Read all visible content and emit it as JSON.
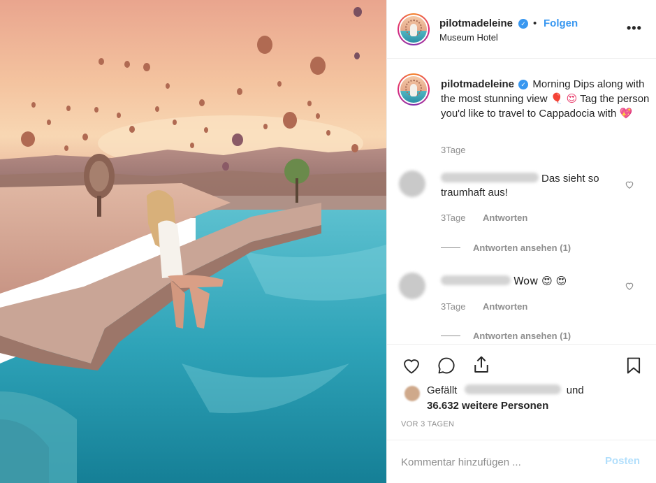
{
  "post": {
    "username": "pilotmadeleine",
    "verified": true,
    "separator": "•",
    "follow_label": "Folgen",
    "location": "Museum Hotel",
    "more_label": "•••"
  },
  "caption": {
    "username": "pilotmadeleine",
    "text_part1": "Morning Dips along with the most stunning view",
    "emoji1": "🎈",
    "emoji2": "😍",
    "text_part2": "Tag the person you'd like to travel to Cappadocia with",
    "emoji3": "💖",
    "time": "3Tage"
  },
  "comments": [
    {
      "text": "Das sieht so traumhaft aus!",
      "time": "3Tage",
      "reply_label": "Antworten",
      "view_replies": "Antworten ansehen (1)"
    },
    {
      "text": "Wow 😍 😍",
      "time": "3Tage",
      "reply_label": "Antworten",
      "view_replies": "Antworten ansehen (1)"
    }
  ],
  "likes": {
    "prefix": "Gefällt",
    "suffix": "und",
    "count_text": "36.632 weitere Personen"
  },
  "timestamp": "VOR 3 TAGEN",
  "comment_box": {
    "placeholder": "Kommentar hinzufügen ...",
    "post_label": "Posten"
  },
  "colors": {
    "accent": "#3897f0",
    "post_disabled": "#b2dffc",
    "muted": "#8e8e8e"
  },
  "icons": [
    "heart-icon",
    "comment-icon",
    "share-icon",
    "bookmark-icon",
    "verified-badge-icon",
    "more-icon"
  ]
}
